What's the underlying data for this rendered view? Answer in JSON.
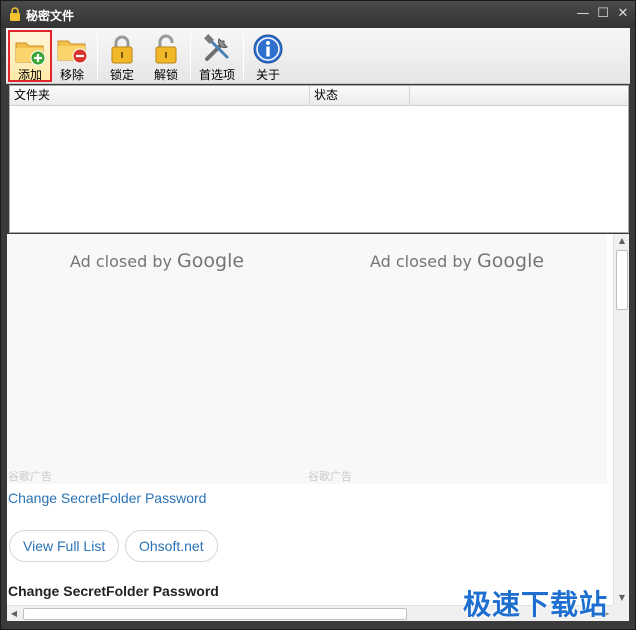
{
  "window": {
    "title": "秘密文件",
    "controls": {
      "minimize": "—",
      "maximize": "☐",
      "close": "✕"
    }
  },
  "toolbar": {
    "add_label": "添加",
    "remove_label": "移除",
    "lock_label": "锁定",
    "unlock_label": "解锁",
    "options_label": "首选项",
    "about_label": "关于"
  },
  "list": {
    "columns": [
      "文件夹",
      "状态"
    ]
  },
  "web": {
    "ad_prefix": "Ad closed by",
    "ad_brand": "Google",
    "ad_label": "谷歌广告",
    "link_text": "Change SecretFolder Password",
    "buttons": [
      "View Full List",
      "Ohsoft.net"
    ],
    "heading": "Change SecretFolder Password"
  },
  "watermark": "极速下载站",
  "colors": {
    "link": "#2a73b5",
    "active_border": "#e0262c",
    "watermark": "#1e6fd0"
  }
}
